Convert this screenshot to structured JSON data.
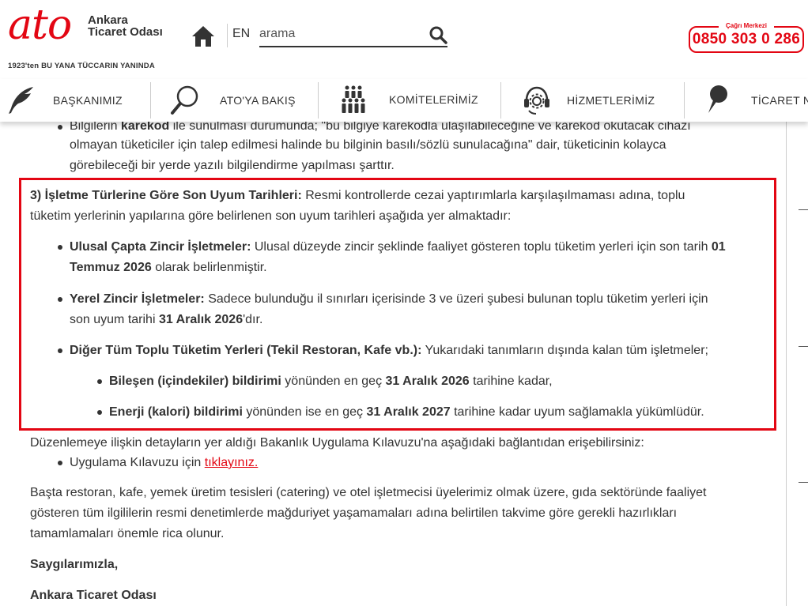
{
  "header": {
    "logo_word": "ato",
    "logo_name_1": "Ankara",
    "logo_name_2": "Ticaret Odası",
    "logo_slogan": "1923'ten BU YANA TÜCCARIN YANINDA",
    "lang": "EN",
    "search_placeholder": "arama",
    "call_center_label": "Çağrı Merkezi",
    "call_center_number": "0850 303 0 286",
    "brand_color": "#e30613"
  },
  "nav": {
    "items": [
      {
        "label": "BAŞKANIMIZ",
        "icon": "quill-icon"
      },
      {
        "label": "ATO'YA BAKIŞ",
        "icon": "magnifier-icon"
      },
      {
        "label": "KOMİTELERİMİZ",
        "icon": "people-group-icon"
      },
      {
        "label": "HİZMETLERİMİZ",
        "icon": "support-headset-icon"
      },
      {
        "label": "TİCARET N",
        "icon": "pin-icon"
      }
    ]
  },
  "content": {
    "top_bullet": {
      "line1_pre": "Bilgilerin ",
      "line1_bold": "karekod",
      "line1_post": " ile sunulması durumunda; \"bu bilgiye karekodla ulaşılabileceğine ve karekod okutacak cihazı",
      "line2": "olmayan tüketiciler için talep edilmesi halinde bu bilginin basılı/sözlü sunulacağına\" dair, tüketicinin kolayca",
      "line3": "görebileceği bir yerde yazılı bilgilendirme yapılması şarttır."
    },
    "section3": {
      "heading_bold": "3) İşletme Türlerine Göre Son Uyum Tarihleri:",
      "heading_rest": " Resmi kontrollerde cezai yaptırımlarla karşılaşılmaması adına, toplu",
      "heading_line2": "tüketim yerlerinin yapılarına göre belirlenen son uyum tarihleri aşağıda yer almaktadır:",
      "b1_bold": "Ulusal Çapta Zincir İşletmeler:",
      "b1_rest": " Ulusal düzeyde zincir şeklinde faaliyet gösteren toplu tüketim yerleri için son tarih ",
      "b1_date_a": "01",
      "b1_date_b": "Temmuz 2026",
      "b1_end": " olarak belirlenmiştir.",
      "b2_bold": "Yerel Zincir İşletmeler:",
      "b2_rest": " Sadece bulunduğu il sınırları içerisinde 3 ve üzeri şubesi bulunan toplu tüketim yerleri için",
      "b2_line2_pre": "son uyum tarihi ",
      "b2_date": "31 Aralık 2026",
      "b2_end": "'dır.",
      "b3_bold": "Diğer Tüm Toplu Tüketim Yerleri (Tekil Restoran, Kafe vb.):",
      "b3_rest": " Yukarıdaki tanımların dışında kalan tüm işletmeler;",
      "sub1_bold": "Bileşen (içindekiler) bildirimi",
      "sub1_mid": " yönünden en geç ",
      "sub1_date": "31 Aralık 2026",
      "sub1_end": " tarihine kadar,",
      "sub2_bold": "Enerji (kalori) bildirimi",
      "sub2_mid": " yönünden ise en geç ",
      "sub2_date": "31 Aralık 2027",
      "sub2_end": " tarihine kadar uyum sağlamakla yükümlüdür."
    },
    "guide_intro": "Düzenlemeye ilişkin detayların yer aldığı Bakanlık Uygulama Kılavuzu'na aşağıdaki bağlantıdan erişebilirsiniz:",
    "guide_item_text": "Uygulama Kılavuzu için ",
    "guide_item_link": "tıklayınız.",
    "closing_line1": "Başta restoran, kafe, yemek üretim tesisleri (catering) ve otel işletmecisi üyelerimiz olmak üzere, gıda sektöründe faaliyet",
    "closing_line2": "gösteren tüm ilgililerin resmi denetimlerde mağduriyet yaşamamaları adına belirtilen takvime göre gerekli hazırlıkları",
    "closing_line3": "tamamlamaları önemle rica olunur.",
    "regards": "Saygılarımızla,",
    "signature": "Ankara Ticaret Odası"
  }
}
